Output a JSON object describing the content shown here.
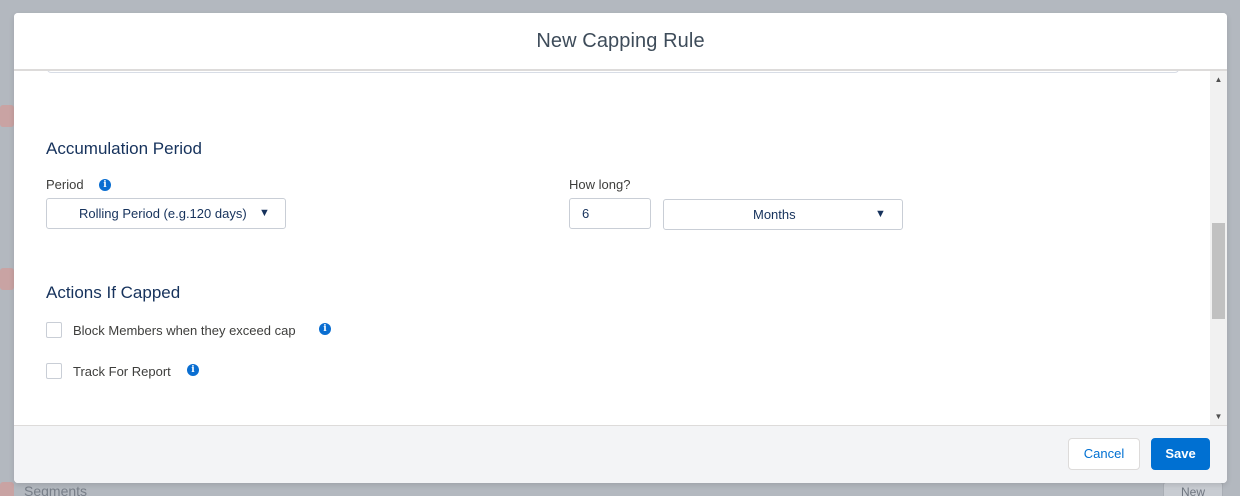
{
  "background": {
    "segments_label": "Segments",
    "new_label": "New"
  },
  "modal": {
    "title": "New Capping Rule"
  },
  "accumulation": {
    "section_title": "Accumulation Period",
    "period_label": "Period",
    "period_value": "Rolling Period (e.g.120 days)",
    "how_long_label": "How long?",
    "how_long_value": "6",
    "unit_value": "Months"
  },
  "actions": {
    "section_title": "Actions If Capped",
    "items": [
      {
        "label": "Block Members when they exceed cap",
        "checked": false
      },
      {
        "label": "Track For Report",
        "checked": false
      }
    ]
  },
  "footer": {
    "cancel_label": "Cancel",
    "save_label": "Save"
  },
  "colors": {
    "brand": "#0070d2",
    "info": "#0a6ed1",
    "title_text": "#16325c"
  },
  "icons": {
    "info": "info-icon",
    "dropdown": "triangle-down-icon",
    "scroll_up": "scroll-up-arrow-icon",
    "scroll_down": "scroll-down-arrow-icon"
  }
}
